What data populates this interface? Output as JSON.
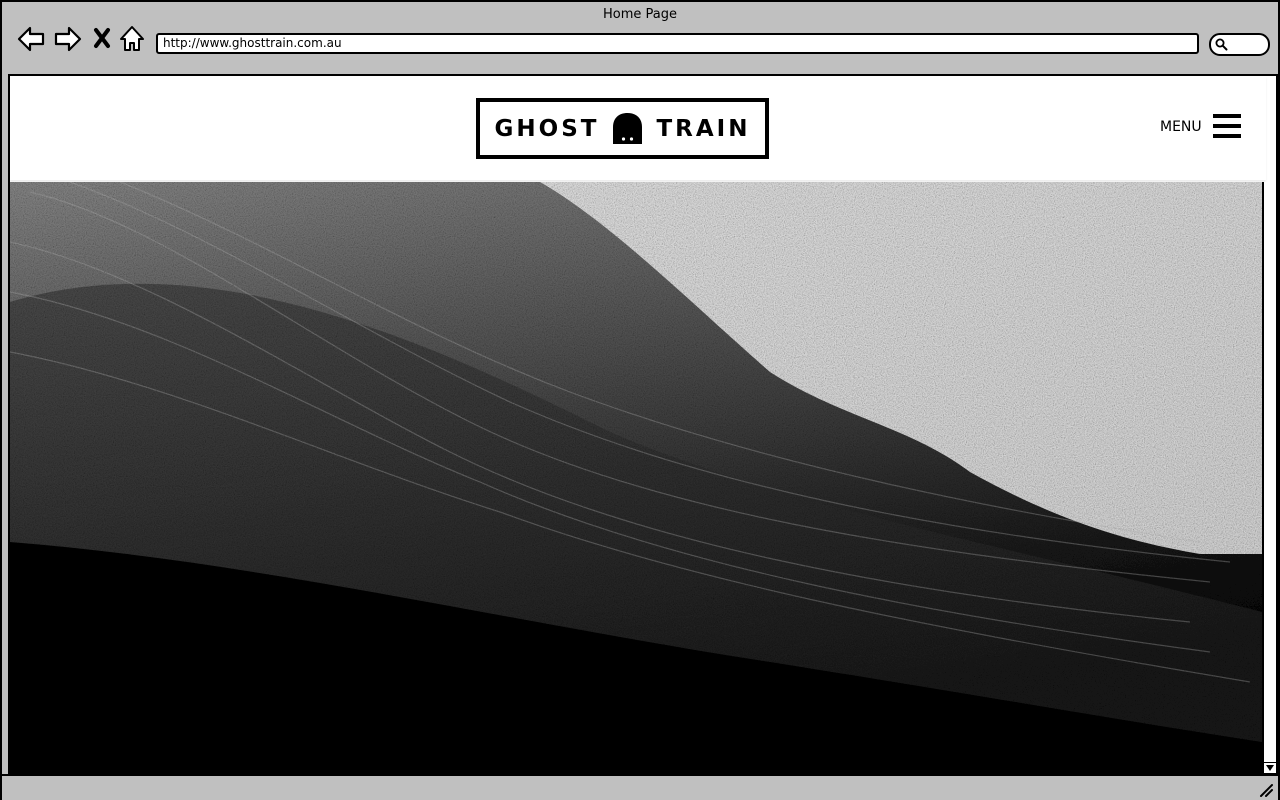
{
  "window": {
    "title": "Home Page"
  },
  "toolbar": {
    "back_icon": "arrow-left-icon",
    "forward_icon": "arrow-right-icon",
    "stop_icon": "close-icon",
    "home_icon": "home-icon",
    "url": "http://www.ghosttrain.com.au",
    "search_icon": "search-icon"
  },
  "site": {
    "logo_left": "GHOST",
    "logo_right": "TRAIN",
    "logo_icon": "ghost-icon",
    "menu_label": "MENU",
    "menu_icon": "hamburger-icon"
  },
  "hero": {
    "image": "mountain-landscape-image"
  },
  "colors": {
    "chrome": "#c0c0c0",
    "ink": "#000000",
    "page": "#ffffff"
  }
}
